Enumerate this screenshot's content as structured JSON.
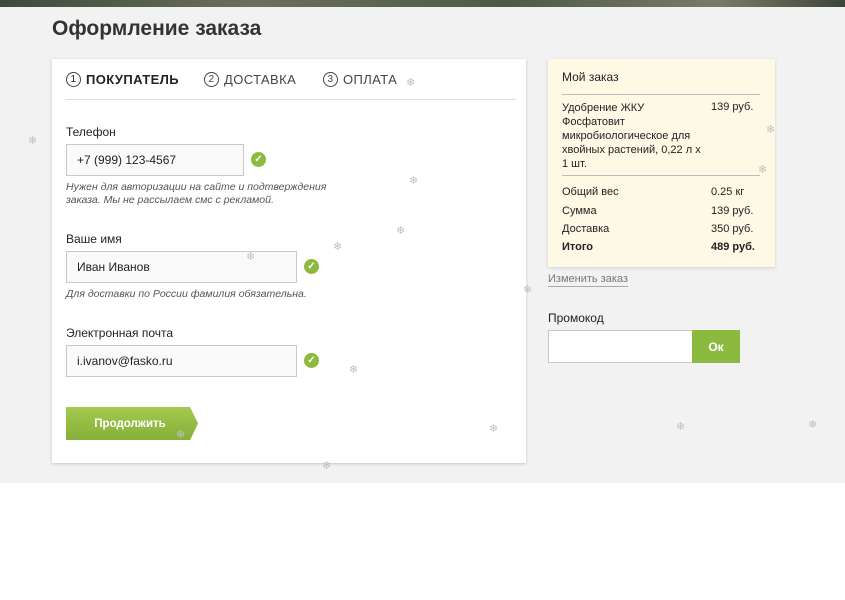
{
  "page": {
    "title": "Оформление заказа"
  },
  "steps": [
    {
      "num": "1",
      "label": "ПОКУПАТЕЛЬ"
    },
    {
      "num": "2",
      "label": "ДОСТАВКА"
    },
    {
      "num": "3",
      "label": "ОПЛАТА"
    }
  ],
  "form": {
    "phone": {
      "label": "Телефон",
      "value": "+7 (999) 123-4567",
      "hint": "Нужен для авторизации на сайте и подтверждения заказа. Мы не рассылаем смс с рекламой."
    },
    "name": {
      "label": "Ваше имя",
      "value": "Иван Иванов",
      "hint": "Для доставки по России фамилия обязательна."
    },
    "email": {
      "label": "Электронная почта",
      "value": "i.ivanov@fasko.ru"
    },
    "continue_label": "Продолжить"
  },
  "order": {
    "title": "Мой заказ",
    "product": {
      "name": "Удобрение ЖКУ Фосфатовит микробиологическое для хвойных растений, 0,22 л х 1 шт.",
      "price": "139 руб."
    },
    "summary": [
      {
        "label": "Общий вес",
        "value": "0.25 кг"
      },
      {
        "label": "Сумма",
        "value": "139 руб."
      },
      {
        "label": "Доставка",
        "value": "350 руб."
      },
      {
        "label": "Итого",
        "value": "489 руб."
      }
    ],
    "edit_label": "Изменить заказ"
  },
  "promo": {
    "label": "Промокод",
    "value": "",
    "button_label": "Ок"
  },
  "icons": {
    "valid": "check-circle-icon",
    "decor": "snowflake-icon",
    "check_color": "#8cba3e",
    "accent": "#94bd43"
  }
}
